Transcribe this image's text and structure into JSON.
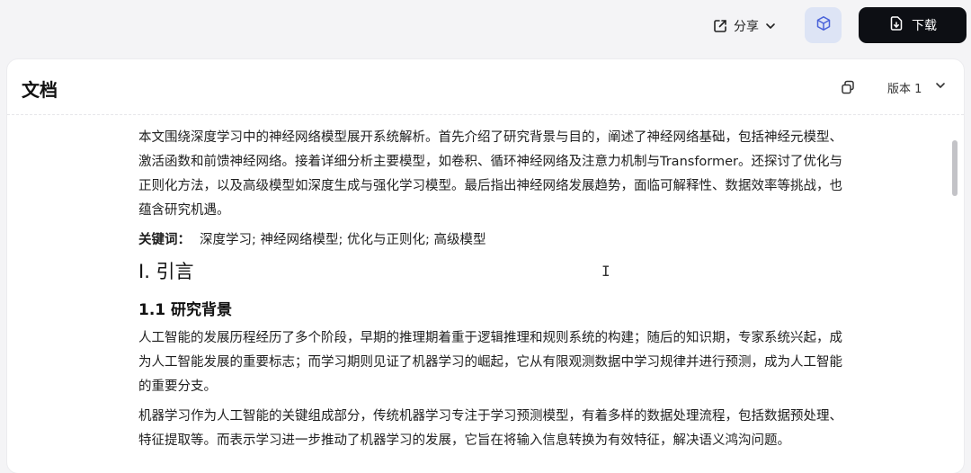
{
  "topbar": {
    "share_label": "分享",
    "download_label": "下载"
  },
  "panel": {
    "title": "文档",
    "version_label": "版本 1"
  },
  "document": {
    "abstract": "本文围绕深度学习中的神经网络模型展开系统解析。首先介绍了研究背景与目的，阐述了神经网络基础，包括神经元模型、激活函数和前馈神经网络。接着详细分析主要模型，如卷积、循环神经网络及注意力机制与Transformer。还探讨了优化与正则化方法，以及高级模型如深度生成与强化学习模型。最后指出神经网络发展趋势，面临可解释性、数据效率等挑战，也蕴含研究机遇。",
    "keywords_label": "关键词：",
    "keywords": "深度学习; 神经网络模型; 优化与正则化; 高级模型",
    "section1_heading": "I. 引言",
    "section1_1_heading": "1.1 研究背景",
    "para1": "人工智能的发展历程经历了多个阶段，早期的推理期着重于逻辑推理和规则系统的构建；随后的知识期，专家系统兴起，成为人工智能发展的重要标志；而学习期则见证了机器学习的崛起，它从有限观测数据中学习规律并进行预测，成为人工智能的重要分支。",
    "para2": "机器学习作为人工智能的关键组成部分，传统机器学习专注于学习预测模型，有着多样的数据处理流程，包括数据预处理、特征提取等。而表示学习进一步推动了机器学习的发展，它旨在将输入信息转换为有效特征，解决语义鸿沟问题。"
  },
  "colors": {
    "download_bg": "#0d0f14",
    "cube_bg": "#dde4f5",
    "cube_icon": "#4a63d9"
  },
  "icons": {
    "share": "share-external-icon",
    "cube": "cube-icon",
    "download": "download-icon",
    "copy": "copy-icon",
    "chevron": "chevron-down-icon"
  }
}
